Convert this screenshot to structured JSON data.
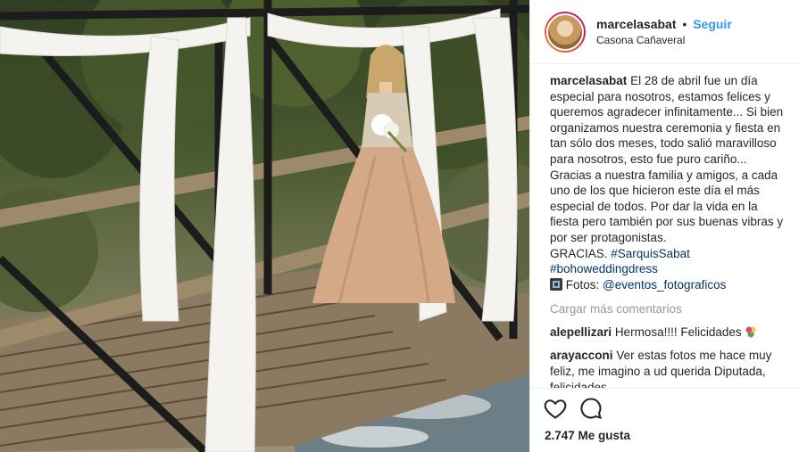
{
  "header": {
    "username": "marcelasabat",
    "separator": "•",
    "follow_label": "Seguir",
    "location": "Casona Cañaveral"
  },
  "caption": {
    "username": "marcelasabat",
    "text": "El 28 de abril fue un día especial para nosotros, estamos felices y queremos agradecer infinitamente... Si bien organizamos nuestra ceremonia y fiesta en tan sólo dos meses, todo salió maravilloso para nosotros, esto fue puro cariño... Gracias a nuestra familia y amigos, a cada uno de los que hicieron este día el más especial de todos. Por dar la vida en la fiesta pero también por sus buenas vibras y por ser protagonistas.",
    "thanks": "GRACIAS.",
    "hashtag_1": "#SarquisSabat",
    "hashtag_2": "#bohoweddingdress",
    "photos_label": "Fotos:",
    "photos_handle": "@eventos_fotograficos"
  },
  "load_more_label": "Cargar más comentarios",
  "comments": [
    {
      "username": "alepellizari",
      "text": "Hermosa!!!! Felicidades"
    },
    {
      "username": "arayacconi",
      "text": "Ver estas fotos me hace muy feliz, me imagino a ud querida Diputada, felicidades"
    }
  ],
  "likes": "2.747 Me gusta",
  "icons": {
    "camera": "camera-emoji-icon",
    "bouquet": "bouquet-emoji-icon",
    "heart": "heart-icon",
    "comment": "comment-icon"
  },
  "colors": {
    "link_blue": "#3897f0",
    "hashtag_blue": "#003569",
    "muted": "#999999",
    "text": "#262626"
  }
}
